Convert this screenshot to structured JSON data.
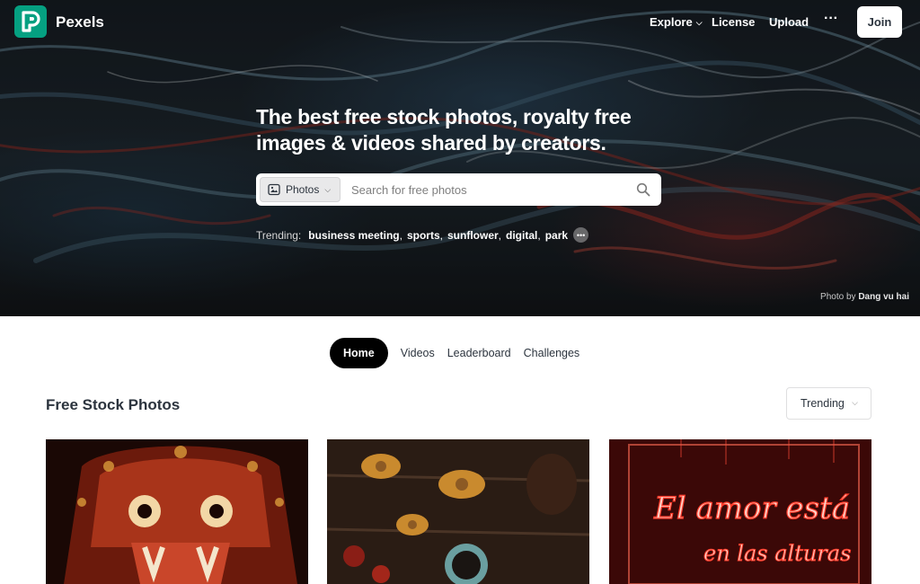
{
  "brand": {
    "name": "Pexels",
    "logo_letter": "P",
    "accent": "#05a081"
  },
  "nav": {
    "explore": "Explore",
    "license": "License",
    "upload": "Upload",
    "more": "···",
    "join": "Join"
  },
  "hero": {
    "headline": "The best free stock photos, royalty free images & videos shared by creators.",
    "search": {
      "type_label": "Photos",
      "placeholder": "Search for free photos"
    },
    "trending_label": "Trending:",
    "trending_tags": [
      "business meeting",
      "sports",
      "sunflower",
      "digital",
      "park"
    ],
    "credit_prefix": "Photo by",
    "credit_name": "Dang vu hai"
  },
  "tabs": [
    {
      "label": "Home",
      "active": true
    },
    {
      "label": "Videos",
      "active": false
    },
    {
      "label": "Leaderboard",
      "active": false
    },
    {
      "label": "Challenges",
      "active": false
    }
  ],
  "section": {
    "title": "Free Stock Photos",
    "sort_label": "Trending"
  },
  "photos": [
    {
      "subject": "barong-mask"
    },
    {
      "subject": "dried-flowers-tea"
    },
    {
      "subject": "neon-sign",
      "neon_line1": "El amor está",
      "neon_line2": "en las alturas"
    }
  ]
}
